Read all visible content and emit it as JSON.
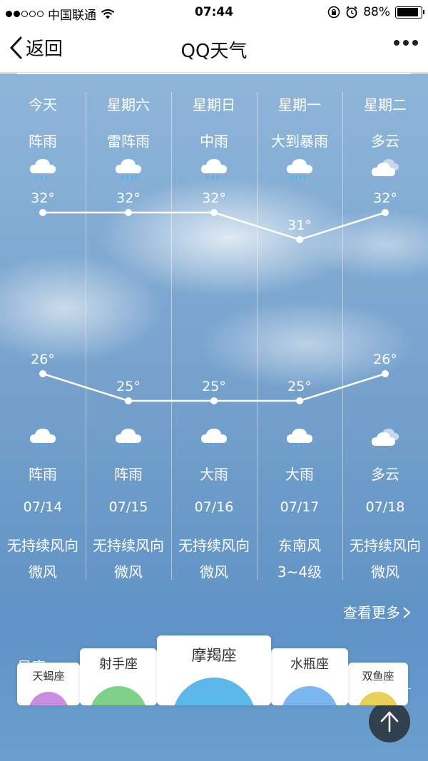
{
  "status_bar": {
    "carrier": "中国联通",
    "time": "07:44",
    "battery": "88%",
    "battery_level": 0.88
  },
  "nav": {
    "back_label": "返回",
    "title": "QQ天气"
  },
  "forecast": [
    {
      "day": "今天",
      "weather_day": "阵雨",
      "high": "32°",
      "low": "26°",
      "weather_night": "阵雨",
      "date": "07/14",
      "wind": "无持续风向",
      "wind_level": "微风",
      "icon": "shower-rain-icon"
    },
    {
      "day": "星期六",
      "weather_day": "雷阵雨",
      "high": "32°",
      "low": "25°",
      "weather_night": "阵雨",
      "date": "07/15",
      "wind": "无持续风向",
      "wind_level": "微风",
      "icon": "thunder-shower-icon"
    },
    {
      "day": "星期日",
      "weather_day": "中雨",
      "high": "32°",
      "low": "25°",
      "weather_night": "大雨",
      "date": "07/16",
      "wind": "无持续风向",
      "wind_level": "微风",
      "icon": "moderate-rain-icon"
    },
    {
      "day": "星期一",
      "weather_day": "大到暴雨",
      "high": "31°",
      "low": "25°",
      "weather_night": "大雨",
      "date": "07/17",
      "wind": "东南风",
      "wind_level": "3~4级",
      "icon": "heavy-rain-icon"
    },
    {
      "day": "星期二",
      "weather_day": "多云",
      "high": "32°",
      "low": "26°",
      "weather_night": "多云",
      "date": "07/18",
      "wind": "无持续风向",
      "wind_level": "微风",
      "icon": "cloudy-icon"
    }
  ],
  "chart_data": {
    "type": "line",
    "categories": [
      "今天",
      "星期六",
      "星期日",
      "星期一",
      "星期二"
    ],
    "series": [
      {
        "values": [
          32,
          32,
          32,
          31,
          32
        ]
      },
      {
        "values": [
          26,
          25,
          25,
          25,
          26
        ]
      }
    ]
  },
  "more_label": "查看更多",
  "section": {
    "title": "星座"
  },
  "zodiac": {
    "items": [
      "天蝎座",
      "射手座",
      "摩羯座",
      "水瓶座",
      "双鱼座"
    ],
    "selected": "摩羯座"
  },
  "colors": {
    "background": "#7ba6cf",
    "text": "#ffffff",
    "zodiac_circle": "#5bb8e8",
    "zodiac_green": "#7fd08a"
  }
}
